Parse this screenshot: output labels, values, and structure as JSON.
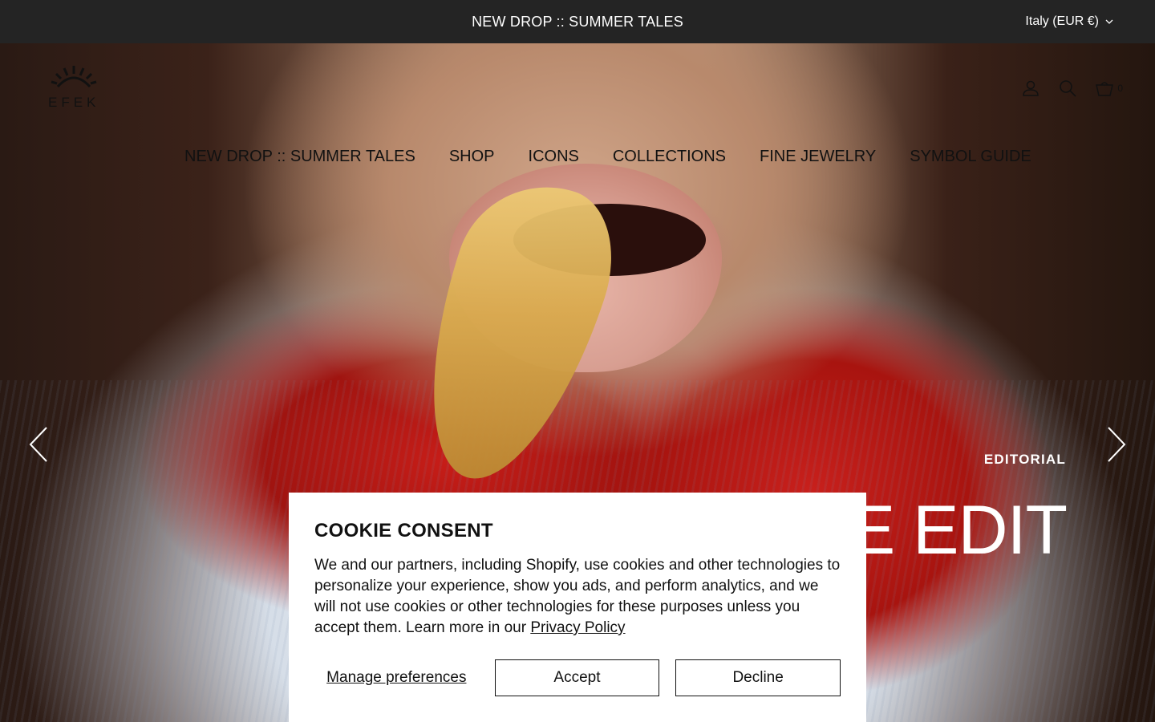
{
  "announcement": {
    "text": "NEW DROP :: SUMMER TALES"
  },
  "locale": {
    "label": "Italy (EUR €)",
    "icon": "chevron-down-icon"
  },
  "brand": {
    "name": "EFEK"
  },
  "header_icons": [
    {
      "name": "account-icon"
    },
    {
      "name": "search-icon"
    },
    {
      "name": "cart-icon"
    }
  ],
  "cart": {
    "count": "0"
  },
  "nav": {
    "items": [
      {
        "label": "NEW DROP :: SUMMER TALES"
      },
      {
        "label": "SHOP"
      },
      {
        "label": "ICONS"
      },
      {
        "label": "COLLECTIONS"
      },
      {
        "label": "FINE JEWELRY"
      },
      {
        "label": "SYMBOL GUIDE"
      }
    ]
  },
  "slide": {
    "kicker": "EDITORIAL",
    "title": "THE EDIT"
  },
  "cookie": {
    "title": "COOKIE CONSENT",
    "body_text": "We and our partners, including Shopify, use cookies and other technologies to personalize your experience, show you ads, and perform analytics, and we will not use cookies or other technologies for these purposes unless you accept them. Learn more in our ",
    "privacy_link": "Privacy Policy",
    "manage_label": "Manage preferences",
    "accept_label": "Accept",
    "decline_label": "Decline"
  },
  "colors": {
    "topbar": "#242424",
    "text": "#111111",
    "overlay_text": "#ffffff"
  }
}
